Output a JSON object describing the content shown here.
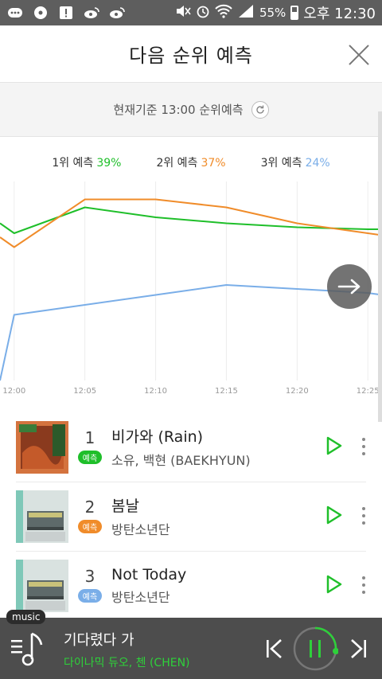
{
  "status_bar": {
    "battery": "55%",
    "time": "오후 12:30",
    "left_icons": [
      "chat-icon",
      "cd-icon",
      "alert-icon",
      "weibo-icon",
      "weibo-icon"
    ],
    "right_icons": [
      "mute-icon",
      "alarm-icon",
      "wifi-icon",
      "signal-icon",
      "battery-icon"
    ]
  },
  "header": {
    "title": "다음 순위 예측"
  },
  "time_bar": {
    "label": "현재기준 13:00 순위예측"
  },
  "legend": [
    {
      "label": "1위 예측",
      "pct": "39%",
      "color": "#1fbf2a"
    },
    {
      "label": "2위 예측",
      "pct": "37%",
      "color": "#f08c2a"
    },
    {
      "label": "3위 예측",
      "pct": "24%",
      "color": "#7aaee8"
    }
  ],
  "chart_data": {
    "type": "line",
    "x": [
      "12:00",
      "12:05",
      "12:10",
      "12:15",
      "12:20",
      "12:25"
    ],
    "xlim": [
      "11:59",
      "12:26"
    ],
    "ylim": [
      0,
      100
    ],
    "grid": "vertical",
    "series": [
      {
        "name": "1위 예측",
        "color": "#1fbf2a",
        "points": [
          [
            "11:59",
            79
          ],
          [
            "12:00",
            74
          ],
          [
            "12:05",
            87
          ],
          [
            "12:10",
            82
          ],
          [
            "12:15",
            79
          ],
          [
            "12:20",
            77
          ],
          [
            "12:25",
            76
          ],
          [
            "12:26",
            76
          ]
        ]
      },
      {
        "name": "2위 예측",
        "color": "#f08c2a",
        "points": [
          [
            "11:59",
            72
          ],
          [
            "12:00",
            67
          ],
          [
            "12:05",
            91
          ],
          [
            "12:10",
            91
          ],
          [
            "12:15",
            87
          ],
          [
            "12:20",
            79
          ],
          [
            "12:25",
            74
          ],
          [
            "12:26",
            73
          ]
        ]
      },
      {
        "name": "3위 예측",
        "color": "#7aaee8",
        "points": [
          [
            "11:59",
            0
          ],
          [
            "12:00",
            33
          ],
          [
            "12:05",
            38
          ],
          [
            "12:10",
            43
          ],
          [
            "12:15",
            48
          ],
          [
            "12:20",
            46
          ],
          [
            "12:25",
            44
          ],
          [
            "12:26",
            43
          ]
        ]
      }
    ]
  },
  "ranking": [
    {
      "rank": "1",
      "title": "비가와 (Rain)",
      "artist": "소유, 백현 (BAEKHYUN)",
      "badge": "예측",
      "badge_color": "#1fbf2a"
    },
    {
      "rank": "2",
      "title": "봄날",
      "artist": "방탄소년단",
      "badge": "예측",
      "badge_color": "#f08c2a"
    },
    {
      "rank": "3",
      "title": "Not Today",
      "artist": "방탄소년단",
      "badge": "예측",
      "badge_color": "#7aaee8"
    }
  ],
  "player": {
    "tag": "music",
    "title": "기다렸다 가",
    "artist": "다이나믹 듀오, 첸 (CHEN)",
    "accent": "#2ed03a"
  }
}
